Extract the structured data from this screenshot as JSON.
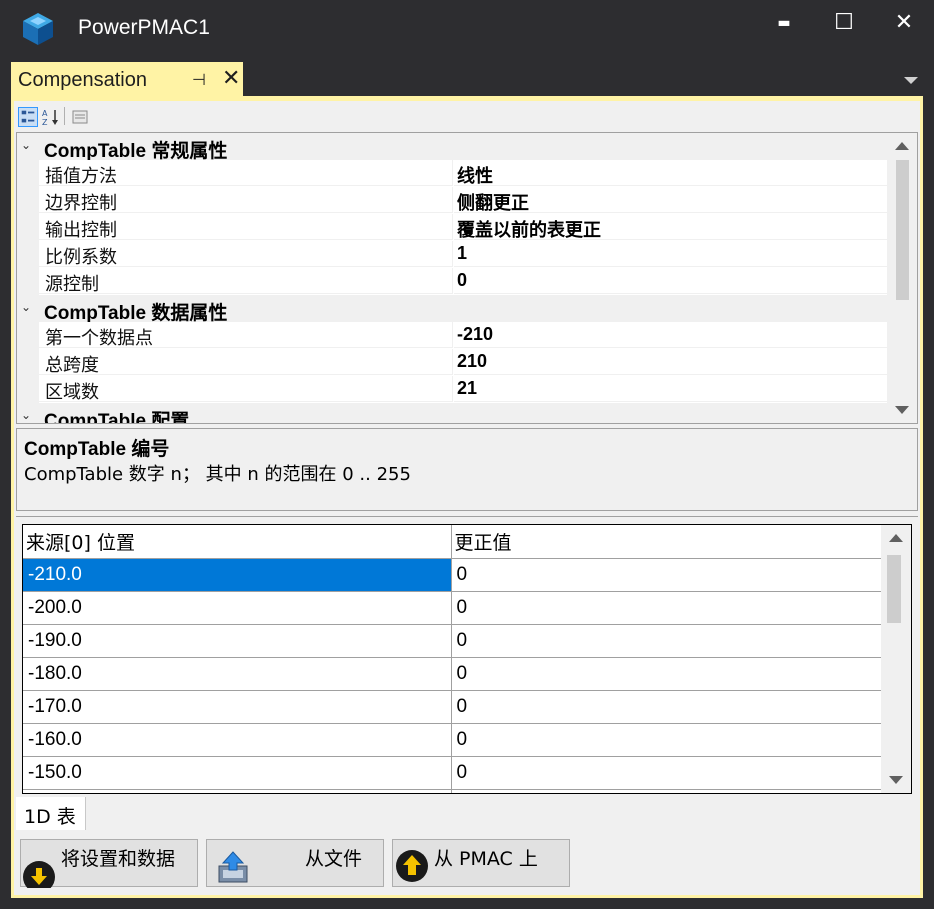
{
  "window": {
    "title": "PowerPMAC1",
    "minimize": "▬",
    "maximize": "☐",
    "close": "✕"
  },
  "tab": {
    "label": "Compensation",
    "pin_glyph": "⊣",
    "close_glyph": "✕"
  },
  "toolbar": {
    "categorized": "categorized-view-icon",
    "alphabetical": "alphabetical-sort-icon",
    "pages": "property-pages-icon"
  },
  "property_grid": {
    "categories": [
      {
        "title": "CompTable 常规属性",
        "properties": [
          {
            "name": "插值方法",
            "value": "线性"
          },
          {
            "name": "边界控制",
            "value": "侧翻更正"
          },
          {
            "name": "输出控制",
            "value": "覆盖以前的表更正"
          },
          {
            "name": "比例系数",
            "value": "1"
          },
          {
            "name": "源控制",
            "value": "0"
          }
        ]
      },
      {
        "title": "CompTable 数据属性",
        "properties": [
          {
            "name": "第一个数据点",
            "value": "-210"
          },
          {
            "name": "总跨度",
            "value": "210"
          },
          {
            "name": "区域数",
            "value": "21"
          }
        ]
      },
      {
        "title": "CompTable 配置",
        "properties": []
      }
    ]
  },
  "description": {
    "title": "CompTable 编号",
    "text": "CompTable 数字 n； 其中 n 的范围在 0 .. 255"
  },
  "table": {
    "columns": [
      "来源[0] 位置",
      "更正值"
    ],
    "rows": [
      [
        "-210.0",
        "0"
      ],
      [
        "-200.0",
        "0"
      ],
      [
        "-190.0",
        "0"
      ],
      [
        "-180.0",
        "0"
      ],
      [
        "-170.0",
        "0"
      ],
      [
        "-160.0",
        "0"
      ],
      [
        "-150.0",
        "0"
      ],
      [
        "",
        ""
      ]
    ],
    "selected_row": 0
  },
  "bottom_tab": {
    "label": "1D 表"
  },
  "buttons": {
    "save": "将设置和数据",
    "from_file": "从文件",
    "from_pmac": "从 PMAC 上"
  },
  "colors": {
    "tab_active": "#fff3a5",
    "selection": "#0078d7",
    "chrome": "#2d2d30"
  }
}
